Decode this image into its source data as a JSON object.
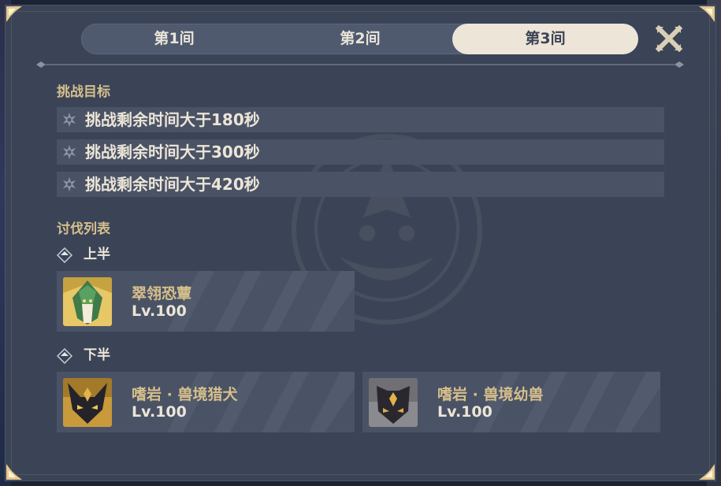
{
  "tabs": [
    {
      "label": "第1间",
      "selected": false
    },
    {
      "label": "第2间",
      "selected": false
    },
    {
      "label": "第3间",
      "selected": true
    }
  ],
  "close_icon": "close-x-icon",
  "challenge_goals": {
    "title": "挑战目标",
    "items": [
      "挑战剩余时间大于180秒",
      "挑战剩余时间大于300秒",
      "挑战剩余时间大于420秒"
    ],
    "item_icon": "star-icon"
  },
  "enemy_list": {
    "title": "讨伐列表",
    "first_half": {
      "label": "上半",
      "enemies": [
        {
          "name": "翠翎恐蕈",
          "level": "Lv.100",
          "portrait": "green-feathered-fungus-portrait"
        }
      ]
    },
    "second_half": {
      "label": "下半",
      "enemies": [
        {
          "name": "嗜岩 · 兽境猎犬",
          "level": "Lv.100",
          "portrait": "dark-hound-portrait"
        },
        {
          "name": "嗜岩 · 兽境幼兽",
          "level": "Lv.100",
          "portrait": "dark-whelp-portrait"
        }
      ]
    }
  },
  "colors": {
    "panel_bg": "#3b4457",
    "row_bg": "#4a5365",
    "gold_text": "#d6bf8c",
    "light_text": "#ece5d8",
    "selected_tab_bg": "#ece5d8"
  }
}
